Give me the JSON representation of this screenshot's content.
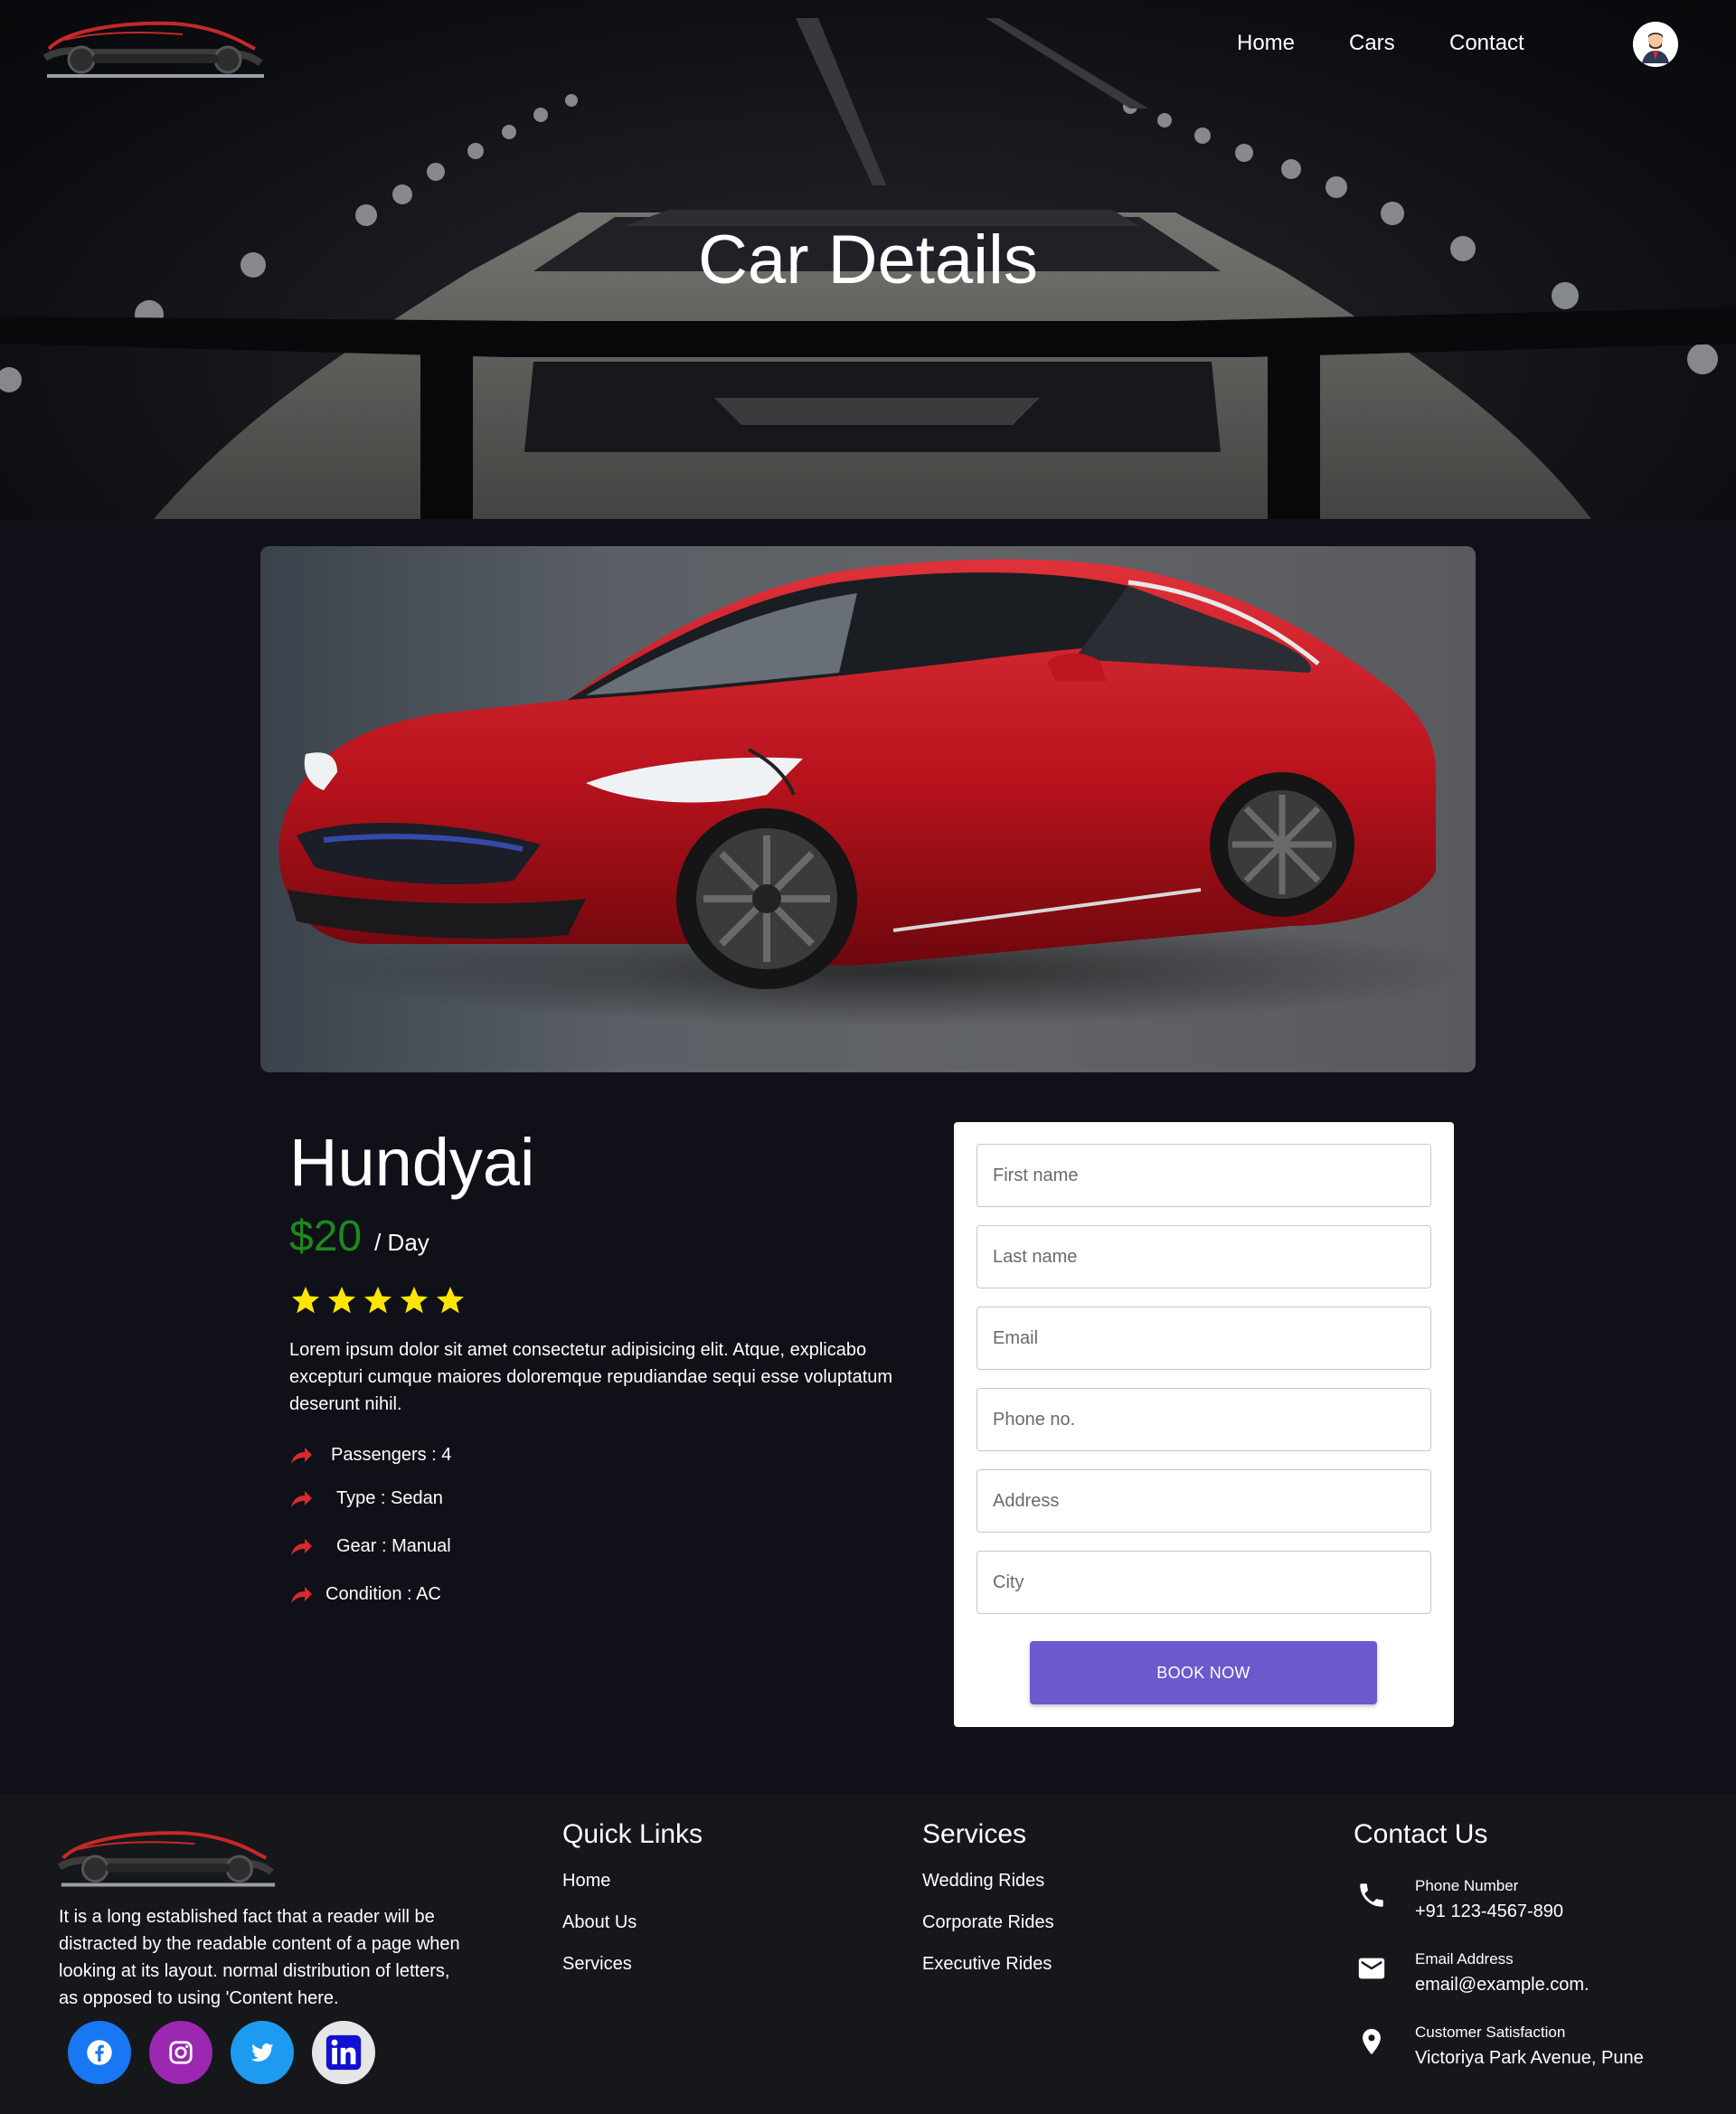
{
  "nav": {
    "home": "Home",
    "cars": "Cars",
    "contact": "Contact"
  },
  "hero": {
    "title": "Car Details"
  },
  "car": {
    "name": "Hundyai",
    "price": "$20",
    "price_unit": "/ Day",
    "rating": 5,
    "description": "Lorem ipsum dolor sit amet consectetur adipisicing elit. Atque, explicabo excepturi cumque maiores doloremque repudiandae sequi esse voluptatum deserunt nihil.",
    "features": [
      "Passengers : 4",
      "Type : Sedan",
      "Gear : Manual",
      "Condition : AC"
    ]
  },
  "form": {
    "first_name": "First name",
    "last_name": "Last name",
    "email": "Email",
    "phone": "Phone no.",
    "address": "Address",
    "city": "City",
    "submit": "BOOK NOW"
  },
  "footer": {
    "about": "It is a long established fact that a reader will be distracted by the readable content of a page when looking at its layout. normal distribution of letters, as opposed to using 'Content here.",
    "quick_links": {
      "title": "Quick Links",
      "items": [
        "Home",
        "About Us",
        "Services"
      ]
    },
    "services": {
      "title": "Services",
      "items": [
        "Wedding Rides",
        "Corporate Rides",
        "Executive Rides"
      ]
    },
    "contact": {
      "title": "Contact Us",
      "phone_label": "Phone Number",
      "phone": "+91 123-4567-890",
      "email_label": "Email Address",
      "email": "email@example.com.",
      "location_label": "Customer Satisfaction",
      "location": "Victoriya Park Avenue, Pune"
    },
    "social": [
      "facebook-icon",
      "instagram-icon",
      "twitter-icon",
      "linkedin-icon"
    ]
  },
  "colors": {
    "brand_red": "#d62b2b",
    "price_green": "#1c8a1c",
    "button_purple": "#6a5acd",
    "star_yellow": "#ffe600",
    "facebook": "#1877f2",
    "instagram": "#9c27b0",
    "twitter": "#1d9bf0"
  }
}
